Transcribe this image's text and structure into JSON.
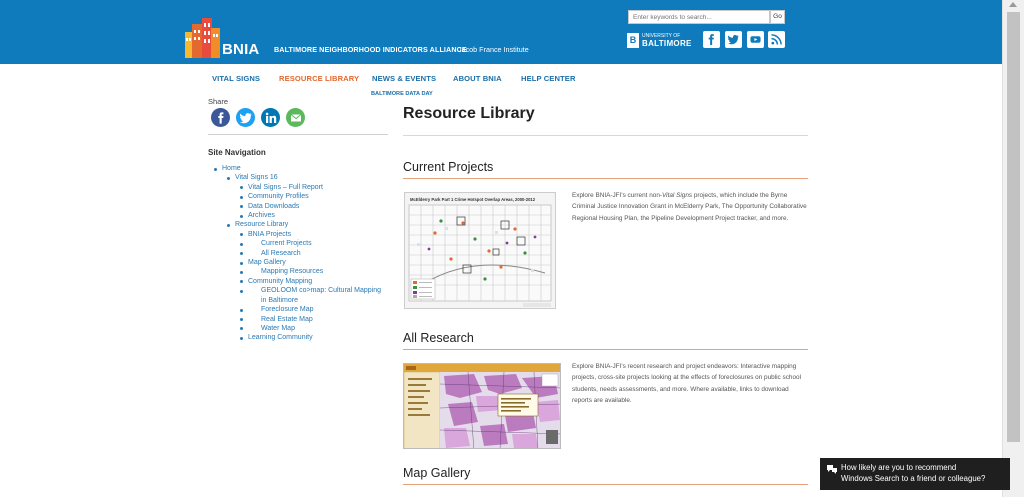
{
  "header": {
    "logo_text": "BNIA",
    "org_name": "BALTIMORE NEIGHBORHOOD INDICATORS ALLIANCE",
    "org_sub": "Jacob France Institute",
    "search_placeholder": "Enter keywords to search...",
    "search_button": "Go",
    "ub_line1": "UNIVERSITY OF",
    "ub_line2": "BALTIMORE",
    "ub_mark": "B",
    "social": [
      "facebook-icon",
      "twitter-icon",
      "youtube-icon",
      "rss-icon"
    ]
  },
  "nav": {
    "items": [
      {
        "label": "VITAL SIGNS",
        "active": false
      },
      {
        "label": "RESOURCE LIBRARY",
        "active": true
      },
      {
        "label": "NEWS & EVENTS",
        "active": false
      },
      {
        "label": "ABOUT BNIA",
        "active": false
      },
      {
        "label": "HELP CENTER",
        "active": false
      }
    ],
    "sub_item": "BALTIMORE DATA DAY"
  },
  "sidebar": {
    "share_label": "Share",
    "share_icons": [
      "facebook-icon",
      "twitter-icon",
      "linkedin-icon",
      "email-icon"
    ],
    "site_nav_title": "Site Navigation",
    "tree": [
      {
        "label": "Home",
        "level": 0
      },
      {
        "label": "Vital Signs 16",
        "level": 1
      },
      {
        "label": "Vital Signs – Full Report",
        "level": 2
      },
      {
        "label": "Community Profiles",
        "level": 2
      },
      {
        "label": "Data Downloads",
        "level": 2
      },
      {
        "label": "Archives",
        "level": 2
      },
      {
        "label": "Resource Library",
        "level": 1
      },
      {
        "label": "BNIA Projects",
        "level": 2
      },
      {
        "label": "Current Projects",
        "level": 3
      },
      {
        "label": "All Research",
        "level": 3
      },
      {
        "label": "Map Gallery",
        "level": 2
      },
      {
        "label": "Mapping Resources",
        "level": 3
      },
      {
        "label": "Community Mapping",
        "level": 2
      },
      {
        "label": "GEOLOOM co>map: Cultural Mapping",
        "level": 3
      },
      {
        "label": "in Baltimore",
        "level": 4
      },
      {
        "label": "Foreclosure Map",
        "level": 3
      },
      {
        "label": "Real Estate Map",
        "level": 3
      },
      {
        "label": "Water Map",
        "level": 3
      },
      {
        "label": "Learning Community",
        "level": 2
      }
    ]
  },
  "main": {
    "page_title": "Resource Library",
    "sections": [
      {
        "title": "Current Projects",
        "text_before_italic": "Explore BNIA-JFI's current non-",
        "text_italic": "Vital Signs",
        "text_after_italic": " projects, which include the Byrne Criminal Justice Innovation Grant in McElderry Park, The Opportunity Collaborative Regional Housing Plan, the Pipeline Development Project tracker, and more.",
        "thumb_title": "McElderry Park Part 1 Crime Hotspot Overlap Areas, 2000-2012"
      },
      {
        "title": "All Research",
        "text": "Explore BNIA-JFI's recent research and project endeavors: Interactive mapping projects, cross-site projects looking at the effects of foreclosures on public school students, needs assessments, and more. Where available, links to download reports are available."
      },
      {
        "title": "Map Gallery"
      }
    ]
  },
  "toast": {
    "line1": "How likely are you to recommend",
    "line2": "Windows Search to a friend or colleague?"
  }
}
